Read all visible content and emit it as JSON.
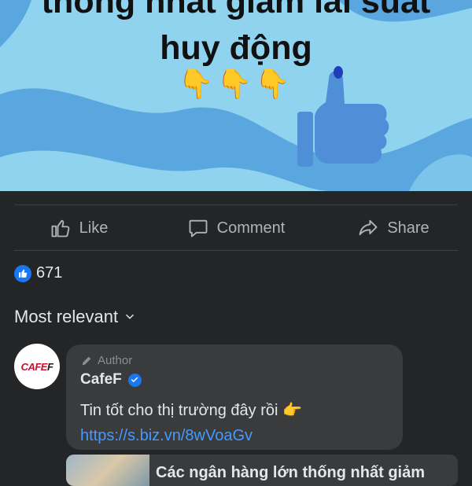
{
  "post": {
    "image_text_line1": "thống nhất giảm lãi suất",
    "image_text_line2": "huy động",
    "image_emojis": "👇👇👇"
  },
  "actions": {
    "like_label": "Like",
    "comment_label": "Comment",
    "share_label": "Share"
  },
  "reactions": {
    "count": "671"
  },
  "sort": {
    "label": "Most relevant"
  },
  "comment": {
    "author_badge": "Author",
    "name": "CafeF",
    "avatar_brand": "CAFEF",
    "text": "Tin tốt cho thị trường đây rồi",
    "emoji": "👉",
    "link": "https://s.biz.vn/8wVoaGv"
  },
  "link_preview": {
    "title": "Các ngân hàng lớn thống nhất giảm"
  },
  "colors": {
    "background": "#242526",
    "hero": "#8fd3ef",
    "accent": "#1877f2",
    "link": "#4599ff"
  }
}
